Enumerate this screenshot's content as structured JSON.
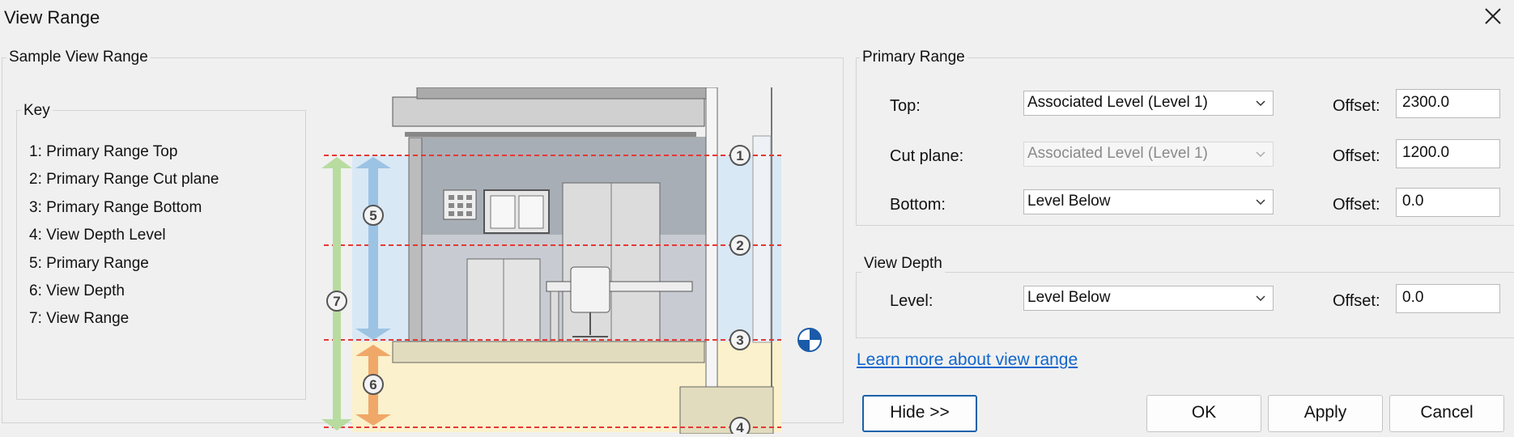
{
  "window": {
    "title": "View Range"
  },
  "sample": {
    "group_title": "Sample View Range",
    "key_title": "Key",
    "key_items": [
      "1: Primary Range Top",
      "2: Primary Range Cut plane",
      "3: Primary Range Bottom",
      "4: View Depth Level",
      "5: Primary Range",
      "6: View Depth",
      "7: View Range"
    ],
    "markers": [
      "1",
      "2",
      "3",
      "4",
      "5",
      "6",
      "7"
    ]
  },
  "primary_range": {
    "title": "Primary Range",
    "rows": [
      {
        "label": "Top:",
        "value": "Associated Level (Level 1)",
        "offset_label": "Offset:",
        "offset": "2300.0",
        "enabled": true
      },
      {
        "label": "Cut plane:",
        "value": "Associated Level (Level 1)",
        "offset_label": "Offset:",
        "offset": "1200.0",
        "enabled": false
      },
      {
        "label": "Bottom:",
        "value": "Level Below",
        "offset_label": "Offset:",
        "offset": "0.0",
        "enabled": true
      }
    ]
  },
  "view_depth": {
    "title": "View Depth",
    "label": "Level:",
    "value": "Level Below",
    "offset_label": "Offset:",
    "offset": "0.0"
  },
  "link": "Learn more about view range",
  "buttons": {
    "hide": "Hide >>",
    "ok": "OK",
    "apply": "Apply",
    "cancel": "Cancel"
  },
  "colors": {
    "link": "#1166cc",
    "primary_button_border": "#1a62a8",
    "guide_line": "#e53935",
    "range_blue": "#9cc3e4",
    "range_orange": "#f0a868",
    "range_green": "#b8dca0"
  },
  "icons": [
    "close-icon",
    "chevron-down-icon",
    "level-marker-icon"
  ]
}
